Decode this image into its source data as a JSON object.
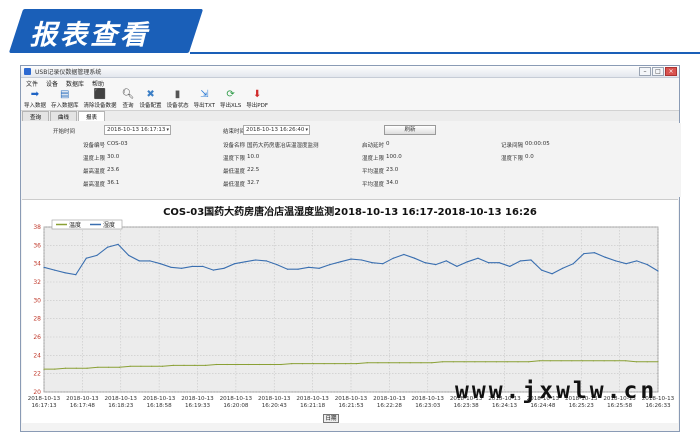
{
  "banner": {
    "title": "报表查看"
  },
  "window": {
    "title": "USB记录仪数据管理系统"
  },
  "menu": [
    "文件",
    "设备",
    "数据库",
    "帮助"
  ],
  "toolbar": [
    {
      "label": "导入数据",
      "icon": "import-icon"
    },
    {
      "label": "存入数据库",
      "icon": "database-save-icon"
    },
    {
      "label": "清除设备数据",
      "icon": "clear-device-icon"
    },
    {
      "label": "查询",
      "icon": "search-icon"
    },
    {
      "label": "设备配置",
      "icon": "tools-icon"
    },
    {
      "label": "设备状态",
      "icon": "device-status-icon"
    },
    {
      "label": "导出TXT",
      "icon": "export-txt-icon"
    },
    {
      "label": "导出XLS",
      "icon": "export-xls-icon"
    },
    {
      "label": "导出PDF",
      "icon": "export-pdf-icon"
    }
  ],
  "tabs": [
    {
      "label": "查询"
    },
    {
      "label": "曲线"
    },
    {
      "label": "报表"
    }
  ],
  "params": {
    "start_time_label": "开始时间",
    "start_time_value": "2018-10-13 16:17:13",
    "end_time_label": "结束时间",
    "end_time_value": "2018-10-13 16:26:40",
    "refresh_label": "刷新",
    "device_no_label": "设备编号",
    "device_no_value": "COS-03",
    "device_name_label": "设备名称",
    "device_name_value": "国药大药房唐冶店温湿度监测",
    "start_delay_label": "启动延时",
    "start_delay_value": "0",
    "record_interval_label": "记录间隔",
    "record_interval_value": "00:00:05",
    "temp_upper_label": "温度上限",
    "temp_upper_value": "30.0",
    "temp_lower_label": "温度下限",
    "temp_lower_value": "10.0",
    "hum_upper_label": "湿度上限",
    "hum_upper_value": "100.0",
    "hum_lower_label": "湿度下限",
    "hum_lower_value": "0.0",
    "max_temp_label": "最高温度",
    "max_temp_value": "23.6",
    "min_temp_label": "最低温度",
    "min_temp_value": "22.5",
    "avg_temp_label": "平均温度",
    "avg_temp_value": "23.0",
    "max_hum_label": "最高湿度",
    "max_hum_value": "36.1",
    "min_hum_label": "最低湿度",
    "min_hum_value": "32.7",
    "avg_hum_label": "平均湿度",
    "avg_hum_value": "34.0"
  },
  "chart_data": {
    "type": "line",
    "title": "COS-03国药大药房唐冶店温湿度监测2018-10-13  16:17-2018-10-13  16:26",
    "legend": "top-left",
    "grid": true,
    "ylim": [
      20,
      38
    ],
    "yticks": [
      "38",
      "36",
      "34",
      "32",
      "30",
      "28",
      "26",
      "24",
      "22",
      "20"
    ],
    "xticks": [
      [
        "2018-10-13",
        "16:17:13"
      ],
      [
        "2018-10-13",
        "16:17:48"
      ],
      [
        "2018-10-13",
        "16:18:23"
      ],
      [
        "2018-10-13",
        "16:18:58"
      ],
      [
        "2018-10-13",
        "16:19:33"
      ],
      [
        "2018-10-13",
        "16:20:08"
      ],
      [
        "2018-10-13",
        "16:20:43"
      ],
      [
        "2018-10-13",
        "16:21:18"
      ],
      [
        "2018-10-13",
        "16:21:53"
      ],
      [
        "2018-10-13",
        "16:22:28"
      ],
      [
        "2018-10-13",
        "16:23:03"
      ],
      [
        "2018-10-13",
        "16:23:38"
      ],
      [
        "2018-10-13",
        "16:24:13"
      ],
      [
        "2018-10-13",
        "16:24:48"
      ],
      [
        "2018-10-13",
        "16:25:23"
      ],
      [
        "2018-10-13",
        "16:25:58"
      ],
      [
        "2018-10-13",
        "16:26:33"
      ]
    ],
    "series": [
      {
        "name": "温度",
        "color": "#8aa035",
        "values": [
          22.5,
          22.5,
          22.6,
          22.6,
          22.6,
          22.7,
          22.7,
          22.7,
          22.8,
          22.8,
          22.8,
          22.8,
          22.9,
          22.9,
          22.9,
          22.9,
          23.0,
          23.0,
          23.0,
          23.0,
          23.0,
          23.0,
          23.0,
          23.1,
          23.1,
          23.1,
          23.1,
          23.1,
          23.1,
          23.1,
          23.2,
          23.2,
          23.2,
          23.2,
          23.2,
          23.2,
          23.2,
          23.3,
          23.3,
          23.3,
          23.3,
          23.3,
          23.3,
          23.3,
          23.3,
          23.3,
          23.4,
          23.4,
          23.4,
          23.4,
          23.4,
          23.4,
          23.4,
          23.4,
          23.4,
          23.3,
          23.3,
          23.3
        ]
      },
      {
        "name": "湿度",
        "color": "#3a6fb0",
        "values": [
          33.6,
          33.3,
          33.0,
          32.8,
          34.6,
          34.9,
          35.8,
          36.1,
          34.9,
          34.3,
          34.3,
          34.0,
          33.6,
          33.5,
          33.7,
          33.7,
          33.3,
          33.5,
          34.0,
          34.2,
          34.4,
          34.3,
          33.9,
          33.4,
          33.4,
          33.6,
          33.5,
          33.9,
          34.2,
          34.5,
          34.4,
          34.1,
          34.0,
          34.6,
          35.0,
          34.6,
          34.1,
          33.9,
          34.3,
          33.7,
          34.2,
          34.6,
          34.1,
          34.1,
          33.7,
          34.3,
          34.4,
          33.3,
          32.9,
          33.5,
          34.0,
          35.1,
          35.2,
          34.7,
          34.3,
          34.0,
          34.3,
          33.9,
          33.2
        ]
      }
    ]
  },
  "scroll": {
    "label": "日期"
  },
  "watermark": {
    "text": "www.jxwlw.cn"
  }
}
